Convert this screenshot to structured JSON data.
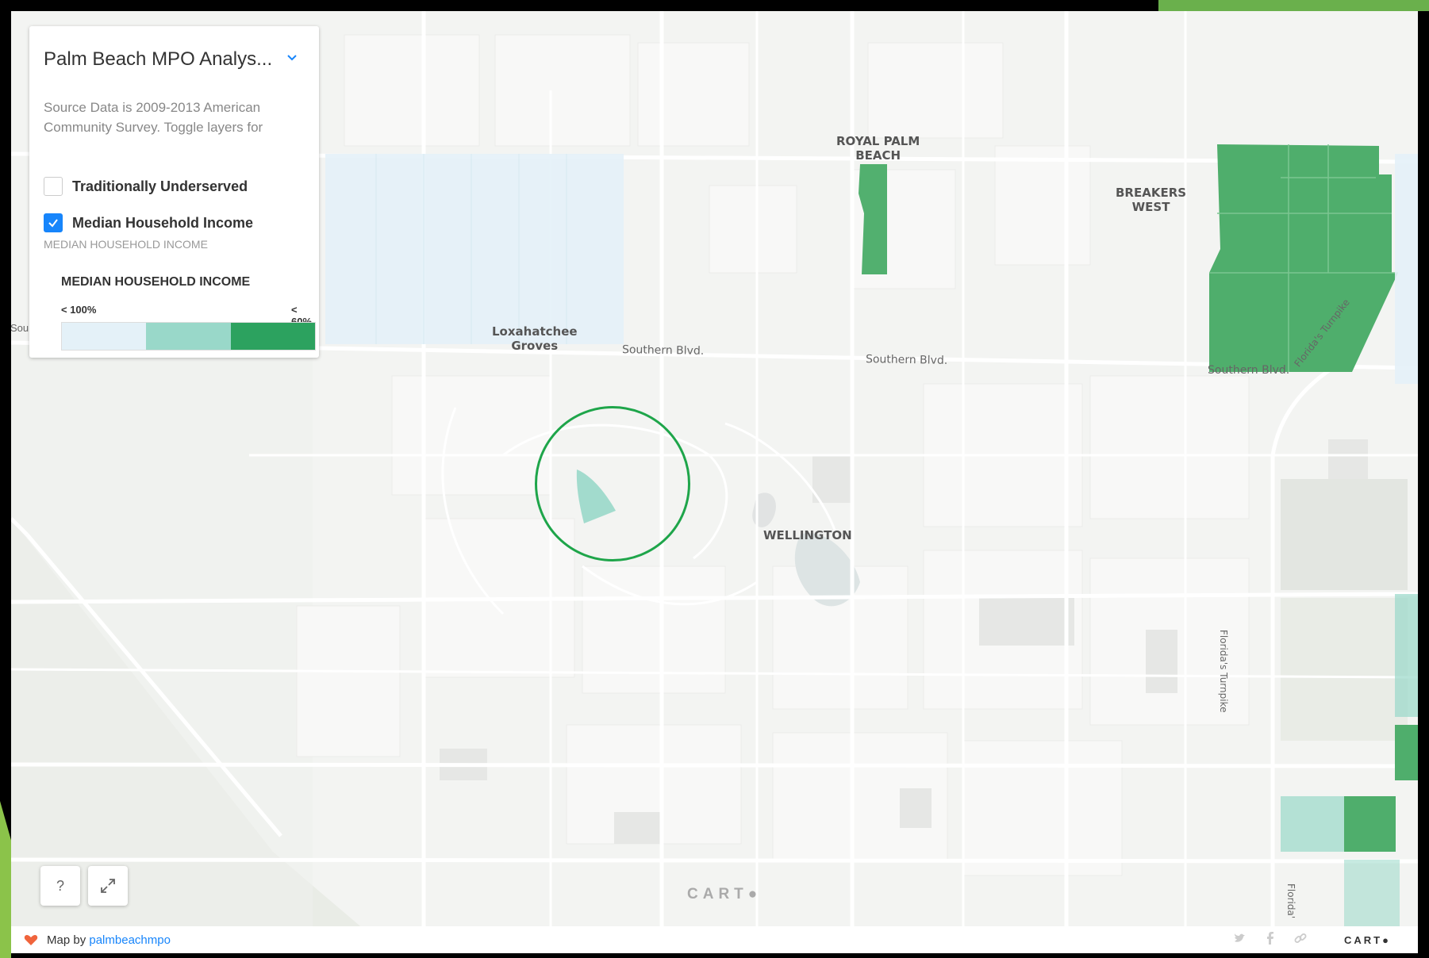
{
  "panel": {
    "title": "Palm Beach MPO Analys...",
    "description": "Source Data is 2009-2013 American Community Survey. Toggle layers for",
    "layers": [
      {
        "label": "Traditionally Underserved",
        "checked": false
      },
      {
        "label": "Median Household Income",
        "checked": true
      }
    ],
    "legend_caption": "MEDIAN HOUSEHOLD INCOME",
    "legend": {
      "title": "MEDIAN HOUSEHOLD INCOME",
      "low_label": "< 100%",
      "high_label": "< 60%",
      "colors": [
        "#e4f1f8",
        "#99d8c9",
        "#2ca25f"
      ]
    },
    "edge_text": "Sou"
  },
  "map": {
    "place_labels": {
      "royal_palm_beach": "ROYAL PALM\nBEACH",
      "breakers_west": "BREAKERS\nWEST",
      "loxahatchee_groves": "Loxahatchee\nGroves",
      "wellington": "WELLINGTON"
    },
    "road_labels": {
      "southern_blvd_1": "Southern Blvd.",
      "southern_blvd_2": "Southern Blvd.",
      "southern_blvd_3": "Southern Blvd.",
      "turnpike_1": "Florida's Turnpike",
      "turnpike_2": "Florida's Turnpike",
      "turnpike_3": "Florida'"
    },
    "watermark": "CART●"
  },
  "controls": {
    "help_label": "?",
    "fullscreen_icon": "expand-icon"
  },
  "footer": {
    "credit_prefix": "Map by",
    "credit_link": "palmbeachmpo",
    "brand": "CART●",
    "icons": [
      "twitter-icon",
      "facebook-icon",
      "link-icon"
    ]
  },
  "colors": {
    "accent": "#1785fb",
    "income_dark": "#2ca25f",
    "income_mid": "#99d8c9",
    "income_light": "#e4f1f8",
    "highlight": "#1ea54a"
  }
}
